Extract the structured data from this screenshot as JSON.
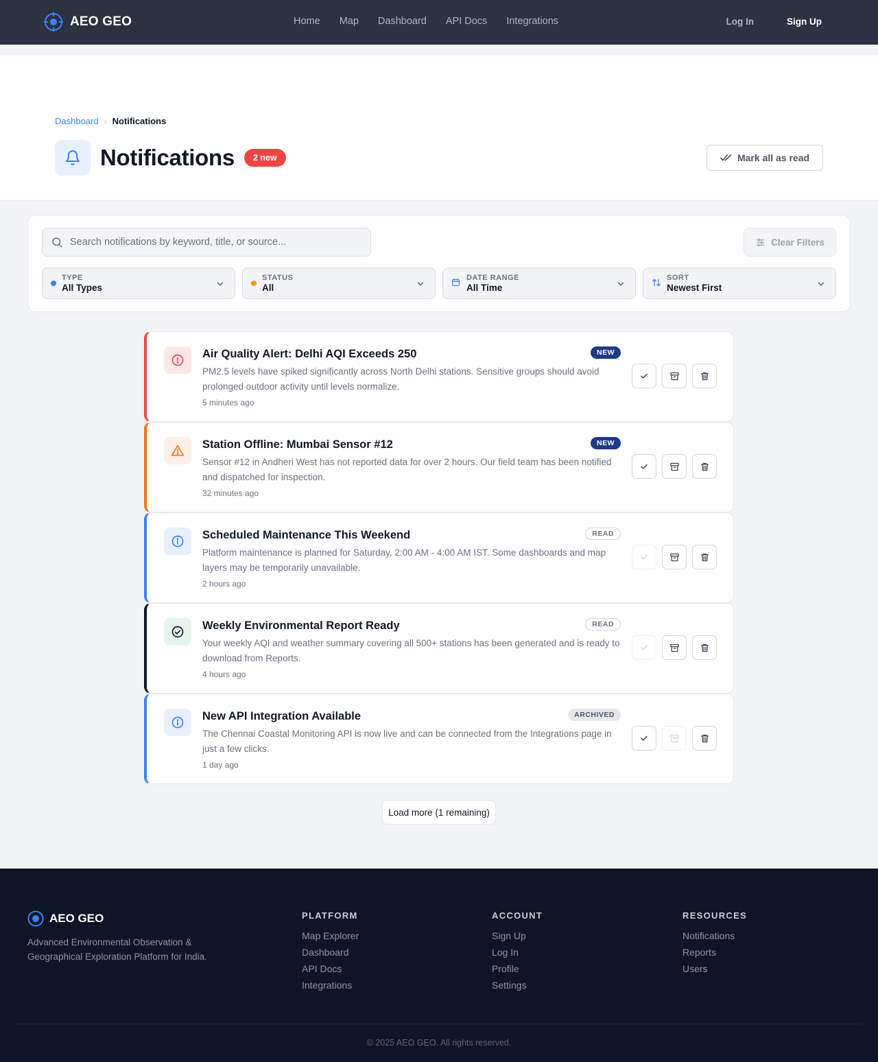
{
  "header": {
    "brand": "AEO GEO",
    "nav": [
      "Home",
      "Map",
      "Dashboard",
      "API Docs",
      "Integrations"
    ],
    "login": "Log In",
    "signup": "Sign Up"
  },
  "breadcrumb": {
    "parent": "Dashboard",
    "current": "Notifications"
  },
  "page": {
    "title": "Notifications",
    "new_badge": "2 new",
    "mark_all": "Mark all as read"
  },
  "filters": {
    "search_placeholder": "Search notifications by keyword, title, or source...",
    "clear": "Clear Filters",
    "type": {
      "label": "TYPE",
      "value": "All Types",
      "dot_color": "#3b82f6"
    },
    "status": {
      "label": "STATUS",
      "value": "All",
      "dot_color": "#f59e0b"
    },
    "date": {
      "label": "DATE RANGE",
      "value": "All Time"
    },
    "sort": {
      "label": "SORT",
      "value": "Newest First"
    }
  },
  "notifications": [
    {
      "title": "Air Quality Alert: Delhi AQI Exceeds 250",
      "body": "PM2.5 levels have spiked significantly across North Delhi stations. Sensitive groups should avoid prolonged outdoor activity until levels normalize.",
      "time": "5 minutes ago",
      "status": "NEW",
      "kind": "alert",
      "accent": "#ef4444"
    },
    {
      "title": "Station Offline: Mumbai Sensor #12",
      "body": "Sensor #12 in Andheri West has not reported data for over 2 hours. Our field team has been notified and dispatched for inspection.",
      "time": "32 minutes ago",
      "status": "NEW",
      "kind": "warning",
      "accent": "#f97316"
    },
    {
      "title": "Scheduled Maintenance This Weekend",
      "body": "Platform maintenance is planned for Saturday, 2:00 AM - 4:00 AM IST. Some dashboards and map layers may be temporarily unavailable.",
      "time": "2 hours ago",
      "status": "READ",
      "kind": "info",
      "accent": "#3b82f6"
    },
    {
      "title": "Weekly Environmental Report Ready",
      "body": "Your weekly AQI and weather summary covering all 500+ stations has been generated and is ready to download from Reports.",
      "time": "4 hours ago",
      "status": "READ",
      "kind": "success",
      "accent": "#111827"
    },
    {
      "title": "New API Integration Available",
      "body": "The Chennai Coastal Monitoring API is now live and can be connected from the Integrations page in just a few clicks.",
      "time": "1 day ago",
      "status": "ARCHIVED",
      "kind": "info",
      "accent": "#3b82f6"
    }
  ],
  "load_more": "Load more (1 remaining)",
  "footer": {
    "brand": "AEO GEO",
    "description": "Advanced Environmental Observation & Geographical Exploration Platform for India.",
    "columns": [
      {
        "heading": "PLATFORM",
        "links": [
          "Map Explorer",
          "Dashboard",
          "API Docs",
          "Integrations"
        ]
      },
      {
        "heading": "ACCOUNT",
        "links": [
          "Sign Up",
          "Log In",
          "Profile",
          "Settings"
        ]
      },
      {
        "heading": "RESOURCES",
        "links": [
          "Notifications",
          "Reports",
          "Users"
        ]
      }
    ],
    "copyright": "© 2025 AEO GEO. All rights reserved."
  }
}
